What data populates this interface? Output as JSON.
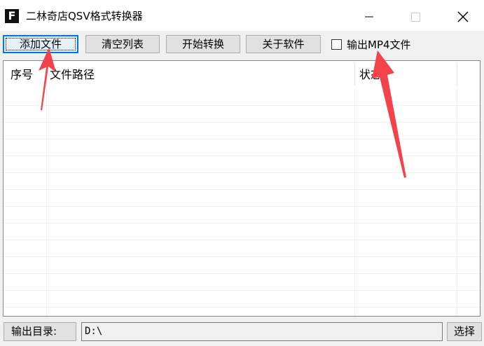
{
  "window": {
    "app_icon_letter": "F",
    "title": "二林奇店QSV格式转换器"
  },
  "toolbar": {
    "add_file_label": "添加文件",
    "clear_list_label": "清空列表",
    "start_convert_label": "开始转换",
    "about_label": "关于软件",
    "output_mp4_label": "输出MP4文件",
    "output_mp4_checked": false
  },
  "list": {
    "columns": [
      "序号",
      "文件路径",
      "状态"
    ],
    "rows": []
  },
  "bottom": {
    "output_dir_label": "输出目录:",
    "output_dir_value": "D:\\",
    "select_label": "选择"
  },
  "colors": {
    "annotation_arrow": "#f2434a",
    "focus_border": "#0078d7"
  },
  "icons": {
    "minimize": "minimize-icon",
    "maximize": "maximize-icon",
    "close": "close-icon",
    "app": "app-icon"
  }
}
